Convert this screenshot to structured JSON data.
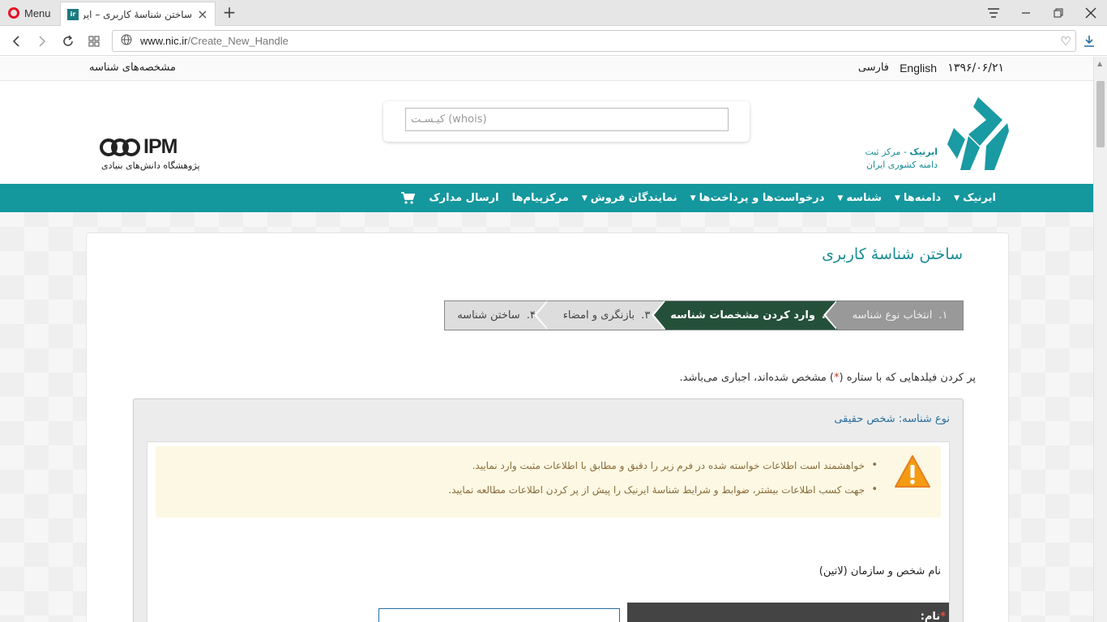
{
  "browser": {
    "menu_label": "Menu",
    "tab_title": "ساختن شناسۀ کاربری – ایرنیک",
    "url_host": "www.nic.ir",
    "url_path": "/Create_New_Handle"
  },
  "topbar": {
    "date": "۱۳۹۶/۰۶/۲۱",
    "english": "English",
    "farsi": "فارسی",
    "handle_link": "مشخصه‌های شناسه"
  },
  "header": {
    "whois_placeholder": "کیـسـت (whois)",
    "ipm_name": "IPM",
    "ipm_subtitle": "پژوهشگاه دانش‌های بنیادی",
    "irnic_brand": "ایرنیک",
    "irnic_line1": " - مرکز ثبت",
    "irnic_line2": "دامنه کشوری ایران"
  },
  "nav": {
    "items": [
      {
        "label": "ایرنیک",
        "caret": true
      },
      {
        "label": "دامنه‌ها",
        "caret": true
      },
      {
        "label": "شناسه",
        "caret": true
      },
      {
        "label": "درخواست‌ها و پرداخت‌ها",
        "caret": true
      },
      {
        "label": "نمایندگان فروش",
        "caret": true
      },
      {
        "label": "مرکزپیام‌ها",
        "caret": false
      },
      {
        "label": "ارسال مدارک",
        "caret": false
      }
    ],
    "cart_icon": "cart-icon"
  },
  "main": {
    "title": "ساختن شناسۀ کاربری",
    "steps": [
      {
        "num": "۱.",
        "label": "انتخاب نوع شناسه"
      },
      {
        "num": "۲.",
        "label": "وارد کردن مشخصات شناسه"
      },
      {
        "num": "۳.",
        "label": "بازنگری و امضاء"
      },
      {
        "num": "۴.",
        "label": "ساختن شناسه"
      }
    ],
    "required_note_before": "پر کردن فیلدهایی که با ستاره (",
    "required_star": "*",
    "required_note_after": ") مشخص شده‌اند، اجباری می‌باشد.",
    "type_label": "نوع شناسه: شخص حقیقی",
    "warnings": [
      "خواهشمند است اطلاعات خواسته شده در فرم زیر را دقیق و مطابق با اطلاعات مثبت وارد نمایید.",
      "جهت کسب اطلاعات بیشتر، ضوابط و شرایط شناسۀ ایرنیک را پیش از پر کردن اطلاعات مطالعه نمایید."
    ],
    "fullname_label": "نام شخص و سازمان (لاتین)",
    "name_label": "نام:",
    "name_star": "*"
  },
  "colors": {
    "teal": "#15979e",
    "active_step": "#24503a",
    "warning_bg": "#fcf8e3"
  }
}
